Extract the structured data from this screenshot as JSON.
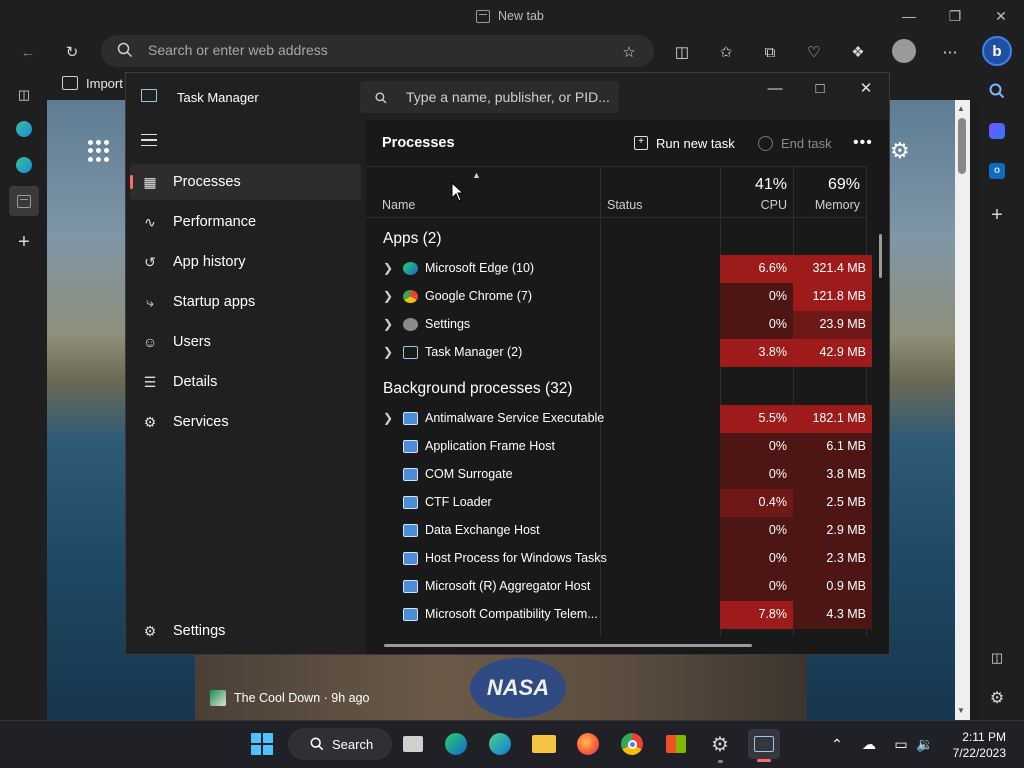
{
  "browser": {
    "tab_title": "New tab",
    "address_placeholder": "Search or enter web address",
    "favorites_import": "Import"
  },
  "page": {
    "news_source": "The Cool Down · 9h ago",
    "nasa_logo": "NASA"
  },
  "task_manager": {
    "title": "Task Manager",
    "search_placeholder": "Type a name, publisher, or PID...",
    "nav": [
      {
        "label": "Processes",
        "icon": "processes-icon",
        "active": true
      },
      {
        "label": "Performance",
        "icon": "performance-icon"
      },
      {
        "label": "App history",
        "icon": "history-icon"
      },
      {
        "label": "Startup apps",
        "icon": "startup-icon"
      },
      {
        "label": "Users",
        "icon": "users-icon"
      },
      {
        "label": "Details",
        "icon": "details-icon"
      },
      {
        "label": "Services",
        "icon": "services-icon"
      }
    ],
    "settings_label": "Settings",
    "section_title": "Processes",
    "run_new_task": "Run new task",
    "end_task": "End task",
    "columns": {
      "name": "Name",
      "status": "Status",
      "cpu_pct": "41%",
      "cpu": "CPU",
      "memory_pct": "69%",
      "memory": "Memory"
    },
    "apps_group": "Apps (2)",
    "apps": [
      {
        "name": "Microsoft Edge (10)",
        "cpu": "6.6%",
        "mem": "321.4 MB",
        "icon": "edge-beta-icon"
      },
      {
        "name": "Google Chrome (7)",
        "cpu": "0%",
        "mem": "121.8 MB",
        "icon": "chrome-icon"
      },
      {
        "name": "Settings",
        "cpu": "0%",
        "mem": "23.9 MB",
        "icon": "settings-gear-icon"
      },
      {
        "name": "Task Manager (2)",
        "cpu": "3.8%",
        "mem": "42.9 MB",
        "icon": "task-manager-icon"
      }
    ],
    "bg_group": "Background processes (32)",
    "background": [
      {
        "name": "Antimalware Service Executable",
        "cpu": "5.5%",
        "mem": "182.1 MB",
        "expandable": true
      },
      {
        "name": "Application Frame Host",
        "cpu": "0%",
        "mem": "6.1 MB"
      },
      {
        "name": "COM Surrogate",
        "cpu": "0%",
        "mem": "3.8 MB"
      },
      {
        "name": "CTF Loader",
        "cpu": "0.4%",
        "mem": "2.5 MB"
      },
      {
        "name": "Data Exchange Host",
        "cpu": "0%",
        "mem": "2.9 MB"
      },
      {
        "name": "Host Process for Windows Tasks",
        "cpu": "0%",
        "mem": "2.3 MB"
      },
      {
        "name": "Microsoft (R) Aggregator Host",
        "cpu": "0%",
        "mem": "0.9 MB"
      },
      {
        "name": "Microsoft Compatibility Telem...",
        "cpu": "7.8%",
        "mem": "4.3 MB"
      }
    ]
  },
  "taskbar": {
    "search_label": "Search",
    "time": "2:11 PM",
    "date": "7/22/2023"
  },
  "colors": {
    "heat_high": "#9e1b1b",
    "heat_mid": "#6e1818",
    "heat_low": "#4e1515",
    "accent": "#ff6a6a"
  }
}
